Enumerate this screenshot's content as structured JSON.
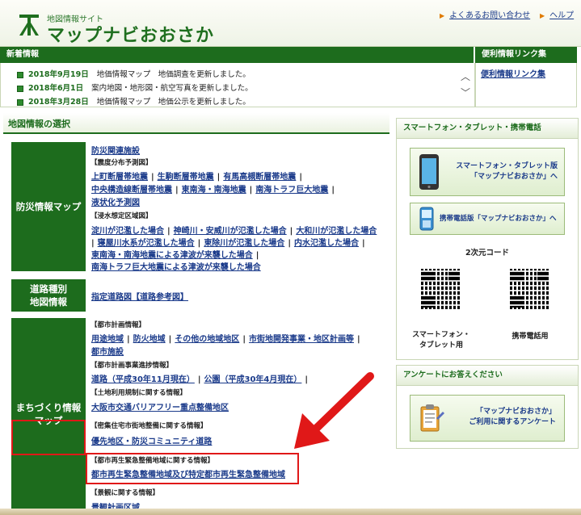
{
  "header": {
    "site_sub": "地図情報サイト",
    "site_title": "マップナビおおさか",
    "links": [
      "よくあるお問い合わせ",
      "ヘルプ"
    ]
  },
  "news": {
    "title": "新着情報",
    "items": [
      {
        "date": "2018年9月19日",
        "text": "地価情報マップ　地価調査を更新しました。"
      },
      {
        "date": "2018年6月1日",
        "text": "案内地図・地形図・航空写真を更新しました。"
      },
      {
        "date": "2018年3月28日",
        "text": "地価情報マップ　地価公示を更新しました。"
      }
    ]
  },
  "quick_links": {
    "title": "便利情報リンク集",
    "link": "便利情報リンク集"
  },
  "map_selection": {
    "title": "地図情報の選択",
    "disaster": {
      "category": "防災情報マップ",
      "top_link": "防災関連施設",
      "sec1": "【震度分布予測図】",
      "sec1_links": [
        "上町断層帯地震",
        "生駒断層帯地震",
        "有馬高槻断層帯地震",
        "中央構造線断層帯地震",
        "東南海・南海地震",
        "南海トラフ巨大地震",
        "液状化予測図"
      ],
      "sec2": "【浸水想定区域図】",
      "sec2_links": [
        "淀川が氾濫した場合",
        "神崎川・安威川が氾濫した場合",
        "大和川が氾濫した場合",
        "寝屋川水系が氾濫した場合",
        "東除川が氾濫した場合",
        "内水氾濫した場合",
        "東南海・南海地震による津波が来襲した場合",
        "南海トラフ巨大地震による津波が来襲した場合"
      ]
    },
    "road": {
      "category_line1": "道路種別",
      "category_line2": "地図情報",
      "link": "指定道路図【道路参考図】"
    },
    "town": {
      "category_line1": "まちづくり情報",
      "category_line2": "マップ",
      "sec1": "【都市計画情報】",
      "sec1_links": [
        "用途地域",
        "防火地域",
        "その他の地域地区",
        "市街地開発事業・地区計画等",
        "都市施設"
      ],
      "sec2": "【都市計画事業進捗情報】",
      "sec2_links": [
        "道路（平成30年11月現在）",
        "公園（平成30年4月現在）"
      ],
      "sec3": "【土地利用規制に関する情報】",
      "sec3_link": "大阪市交通バリアフリー重点整備地区",
      "sec4": "【密集住宅市街地整備に関する情報】",
      "sec4_link": "優先地区・防災コミュニティ道路",
      "sec5": "【都市再生緊急整備地域に関する情報】",
      "sec5_link": "都市再生緊急整備地域及び特定都市再生緊急整備地域",
      "sec6": "【景観に関する情報】",
      "sec6_link": "景観計画区域"
    }
  },
  "smartphone": {
    "title": "スマートフォン・タブレット・携帯電話",
    "btn1_line1": "スマートフォン・タブレット版",
    "btn1_line2": "「マップナビおおさか」へ",
    "btn2": "携帯電話版「マップナビおおさか」へ",
    "qr_title": "2次元コード",
    "qr1_label_line1": "スマートフォン・",
    "qr1_label_line2": "タブレット用",
    "qr2_label": "携帯電話用"
  },
  "survey": {
    "title": "アンケートにお答えください",
    "btn_line1": "「マップナビおおさか」",
    "btn_line2": "ご利用に関するアンケート"
  },
  "colors": {
    "brand_green": "#1d6c1d",
    "annotation_red": "#e01818",
    "link_blue": "#1a3a8a"
  }
}
